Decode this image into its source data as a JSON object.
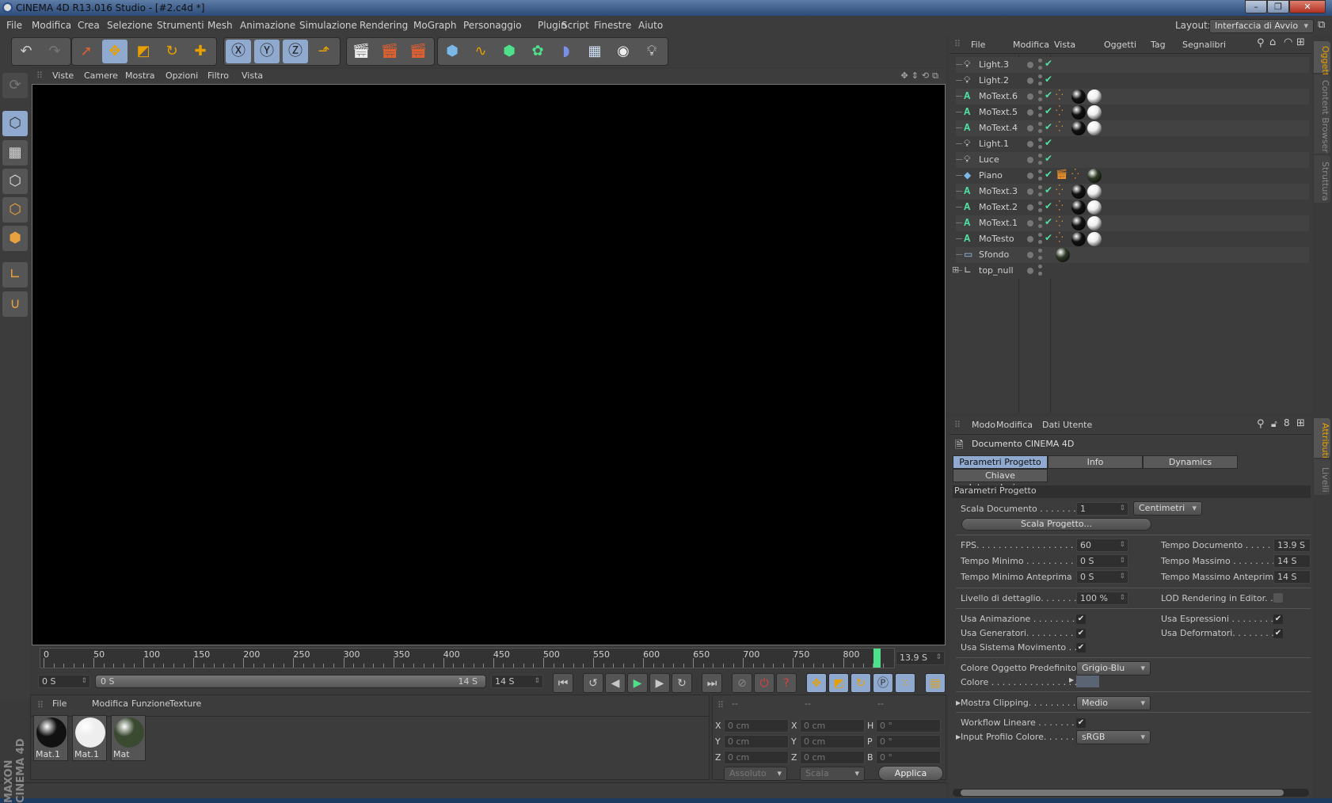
{
  "window": {
    "title": "CINEMA 4D R13.016 Studio - [#2.c4d *]"
  },
  "menu": [
    "File",
    "Modifica",
    "Crea",
    "Selezione",
    "Strumenti",
    "Mesh",
    "Animazione",
    "Simulazione",
    "Rendering",
    "MoGraph",
    "Personaggio",
    "Plugin",
    "Script",
    "Finestre",
    "Aiuto"
  ],
  "layout": {
    "label": "Layout:",
    "value": "Interfaccia di Avvio"
  },
  "toolbar": {
    "icons": [
      "undo-icon",
      "redo-icon",
      "live-selection-icon",
      "move-icon",
      "scale-icon",
      "rotate-icon",
      "last-tool-icon",
      "x-axis-icon",
      "y-axis-icon",
      "z-axis-icon",
      "coordinate-system-icon",
      "render-view-icon",
      "render-picture-viewer-icon",
      "render-settings-icon",
      "cube-icon",
      "spline-icon",
      "nurbs-icon",
      "array-icon",
      "deformer-icon",
      "floor-icon",
      "camera-icon",
      "light-icon"
    ]
  },
  "viewport": {
    "menu": [
      "Viste",
      "Camere",
      "Mostra",
      "Opzioni",
      "Filtro",
      "Vista"
    ]
  },
  "timeline": {
    "ticks": [
      0,
      50,
      100,
      150,
      200,
      250,
      300,
      350,
      400,
      450,
      500,
      550,
      600,
      650,
      700,
      750,
      800
    ],
    "max_frame": 840,
    "current_frame": 834,
    "current_time": "13.9 S",
    "start": "0 S",
    "range_start": "0 S",
    "range_end": "14 S",
    "end": "14 S"
  },
  "materials": {
    "menu": [
      "File",
      "Modifica",
      "Funzione",
      "Texture"
    ],
    "items": [
      {
        "name": "Mat.1",
        "color": "#111"
      },
      {
        "name": "Mat.1",
        "color": "#eee"
      },
      {
        "name": "Mat",
        "color": "#3a4a30"
      }
    ]
  },
  "coords": {
    "headers": [
      "--",
      "--",
      "--"
    ],
    "rows": [
      [
        "X",
        "0 cm",
        "X",
        "0 cm",
        "H",
        "0 °"
      ],
      [
        "Y",
        "0 cm",
        "Y",
        "0 cm",
        "P",
        "0 °"
      ],
      [
        "Z",
        "0 cm",
        "Z",
        "0 cm",
        "B",
        "0 °"
      ]
    ],
    "mode1": "Assoluto",
    "mode2": "Scala",
    "apply": "Applica"
  },
  "branding": "MAXON CINEMA 4D",
  "objects": {
    "menu": [
      "File",
      "Modifica",
      "Vista",
      "Oggetti",
      "Tag",
      "Segnalibri"
    ],
    "items": [
      {
        "name": "Light.3",
        "type": "light",
        "tags": []
      },
      {
        "name": "Light.2",
        "type": "light",
        "tags": []
      },
      {
        "name": "MoText.6",
        "type": "motext",
        "tags": [
          "dots",
          "black",
          "white"
        ]
      },
      {
        "name": "MoText.5",
        "type": "motext",
        "tags": [
          "dots",
          "black",
          "white"
        ]
      },
      {
        "name": "MoText.4",
        "type": "motext",
        "tags": [
          "dots",
          "black",
          "white"
        ]
      },
      {
        "name": "Light.1",
        "type": "light",
        "tags": []
      },
      {
        "name": "Luce",
        "type": "light",
        "tags": []
      },
      {
        "name": "Piano",
        "type": "plane",
        "tags": [
          "clapper",
          "dots",
          "green"
        ]
      },
      {
        "name": "MoText.3",
        "type": "motext",
        "tags": [
          "dots",
          "black",
          "white"
        ]
      },
      {
        "name": "MoText.2",
        "type": "motext",
        "tags": [
          "dots",
          "black",
          "white"
        ]
      },
      {
        "name": "MoText.1",
        "type": "motext",
        "tags": [
          "dots",
          "black",
          "white"
        ]
      },
      {
        "name": "MoTesto",
        "type": "motext",
        "tags": [
          "dots",
          "black",
          "white"
        ]
      },
      {
        "name": "Sfondo",
        "type": "background",
        "tags": [
          "green"
        ]
      },
      {
        "name": "top_null",
        "type": "null",
        "tags": []
      }
    ]
  },
  "side_tabs_top": [
    "Oggetti",
    "Content Browser",
    "Struttura"
  ],
  "side_tabs_bottom": [
    "Attributi",
    "Livelli"
  ],
  "attributes": {
    "menu": [
      "Modo",
      "Modifica",
      "Dati Utente"
    ],
    "object": "Documento CINEMA 4D",
    "tabs": [
      "Parametri Progetto",
      "Info",
      "Dynamics",
      "Chiave Interpolazione"
    ],
    "section": "Parametri Progetto",
    "scala_documento": {
      "label": "Scala Documento . . . . . . . . .",
      "value": "1",
      "unit": "Centimetri"
    },
    "scala_progetto": "Scala Progetto...",
    "fps": {
      "label": "FPS. . . . . . . . . . . . . . . . . . . .",
      "value": "60"
    },
    "tempo_minimo": {
      "label": "Tempo Minimo . . . . . . . . . . .",
      "value": "0 S"
    },
    "tempo_minimo_anteprima": {
      "label": "Tempo Minimo Anteprima",
      "value": "0 S"
    },
    "tempo_documento": {
      "label": "Tempo Documento . . . . . .",
      "value": "13.9 S"
    },
    "tempo_massimo": {
      "label": "Tempo Massimo . . . . . . . . .",
      "value": "14 S"
    },
    "tempo_massimo_anteprima": {
      "label": "Tempo Massimo Anteprima",
      "value": "14 S"
    },
    "livello": {
      "label": "Livello di dettaglio. . . . . . . .",
      "value": "100 %"
    },
    "lod": {
      "label": "LOD Rendering in Editor. .",
      "checked": false
    },
    "usa_animazione": {
      "label": "Usa Animazione . . . . . . . . . .",
      "checked": true
    },
    "usa_generatori": {
      "label": "Usa Generatori. . . . . . . . . . .",
      "checked": true
    },
    "usa_sistema": {
      "label": "Usa Sistema Movimento . . .",
      "checked": true
    },
    "usa_espressioni": {
      "label": "Usa Espressioni . . . . . . . . .",
      "checked": true
    },
    "usa_deformatori": {
      "label": "Usa Deformatori. . . . . . . . .",
      "checked": true
    },
    "colore_oggetto": {
      "label": "Colore Oggetto Predefinito",
      "value": "Grigio-Blu"
    },
    "colore": {
      "label": "Colore . . . . . . . . . . . . . . . .",
      "value": "#5a6472"
    },
    "mostra_clipping": {
      "label": "Mostra Clipping. . . . . . . . . .",
      "value": "Medio"
    },
    "workflow": {
      "label": "Workflow Lineare . . . . . . . .",
      "checked": true
    },
    "input_profilo": {
      "label": "Input Profilo Colore. . . . . . .",
      "value": "sRGB"
    }
  },
  "colors": {
    "accent": "#8fa9cf",
    "active_tab": "#e8a000",
    "check": "#4ee0a0",
    "playhead": "#4ee08a"
  }
}
